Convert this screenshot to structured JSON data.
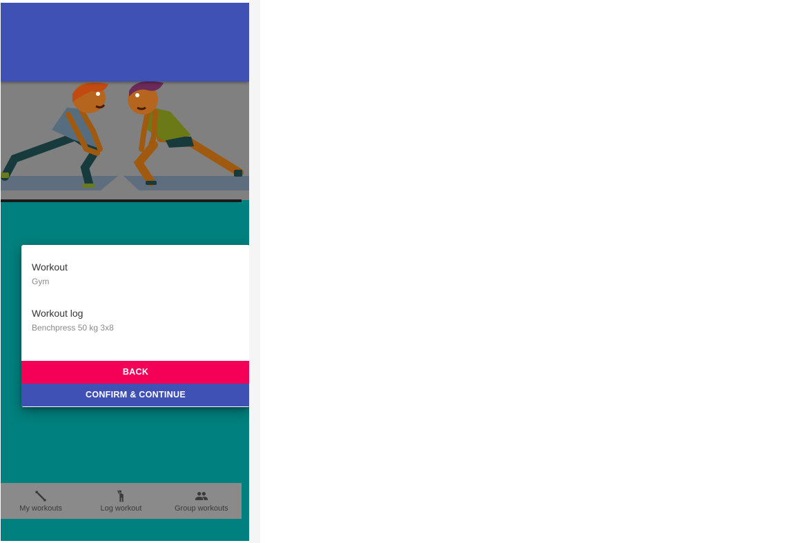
{
  "card": {
    "fields": [
      {
        "label": "Workout",
        "value": "Gym"
      },
      {
        "label": "Workout log",
        "value": "Benchpress 50 kg 3x8"
      }
    ],
    "back_label": "BACK",
    "confirm_label": "CONFIRM & CONTINUE"
  },
  "bottom_nav": {
    "items": [
      {
        "label": "My workouts",
        "icon": "dumbbell-icon"
      },
      {
        "label": "Log workout",
        "icon": "person-exercise-icon"
      },
      {
        "label": "Group workouts",
        "icon": "group-icon"
      }
    ]
  },
  "colors": {
    "app_bar": "#3f51b5",
    "background": "#00807e",
    "back_button": "#f50057",
    "confirm_button": "#3f51b5"
  }
}
